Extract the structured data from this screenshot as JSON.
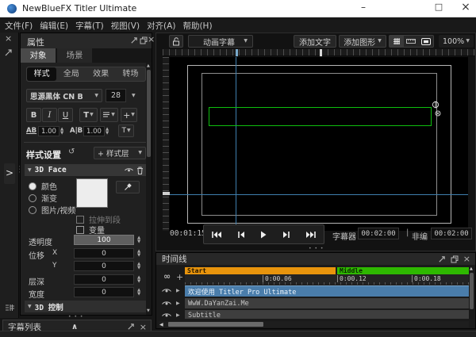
{
  "icons": {
    "close": "×",
    "minimize": "–",
    "maximize": "□",
    "chevron_down": "▼",
    "chevron_right": ">",
    "play_small": "▶",
    "collapse_up": "∧",
    "up": "▲",
    "down": "▼",
    "left": "◀",
    "link": "∞",
    "plus": "+",
    "reset": "↺",
    "dots_h": "• • •",
    "dots_v": "•••",
    "divider": "|"
  },
  "titlebar": {
    "title": "NewBlueFX Titler Ultimate"
  },
  "menubar": {
    "items": [
      "文件(F)",
      "编辑(E)",
      "字幕(T)",
      "视图(V)",
      "对齐(A)",
      "帮助(H)"
    ]
  },
  "properties": {
    "title": "属性",
    "tab_object": "对象",
    "tab_scene": "场景",
    "subtab_style": "样式",
    "subtab_global": "全局",
    "subtab_effects": "效果",
    "subtab_transitions": "转场",
    "font_name": "思源黑体 CN B",
    "font_size": "28",
    "bold": "B",
    "italic": "I",
    "underline": "U",
    "text_style": "T",
    "add": "+",
    "tracking_label": "AB",
    "tracking_value": "1.00",
    "leading_label": "A|B",
    "leading_value": "1.00",
    "baseline_label": "T",
    "style_settings_label": "样式设置",
    "add_style_layer": "+ 样式层",
    "layer_name": "3D Face",
    "fill_color": "颜色",
    "fill_gradient": "渐变",
    "fill_image": "图片/视频",
    "swatch_color": "#ededed",
    "stretch_label": "拉伸到段",
    "variable_label": "变量",
    "opacity_label": "透明度",
    "opacity_value": "100",
    "offset_label": "位移",
    "offset_x_label": "X",
    "offset_x": "0",
    "offset_y_label": "Y",
    "offset_y": "0",
    "depth_label": "层深",
    "depth_value": "0",
    "width_label": "宽度",
    "width_value": "0",
    "controls_3d_label": "3D 控制"
  },
  "subtitle_list": {
    "title": "字幕列表"
  },
  "canvas": {
    "template_dropdown": "动画字幕",
    "add_text": "添加文字",
    "add_shape": "添加图形",
    "zoom": "100%",
    "current_time": "00:01:15",
    "titler_label": "字幕器",
    "titler_time": "00:02:00",
    "nle_label": "非编",
    "nle_time": "00:02:00"
  },
  "timeline": {
    "title": "时间线",
    "segment_start": "Start",
    "segment_middle": "Middle",
    "segment_start_color": "#e8940c",
    "segment_middle_color": "#2eb800",
    "ruler": [
      "0:00.06",
      "0:00.12",
      "0:00.18"
    ],
    "tracks": [
      {
        "text": "欢迎使用 Titler Pro Ultimate"
      },
      {
        "text": "WwW.DaYanZai.Me"
      },
      {
        "text": "Subtitle"
      }
    ]
  },
  "colors": {
    "selection_green": "#0ebe0e",
    "guide_blue": "#3f7fae",
    "selected_track_blue": "#4a7dab",
    "titlebar_bg": "#ffffff",
    "app_icon_blue": "#1565c0"
  }
}
